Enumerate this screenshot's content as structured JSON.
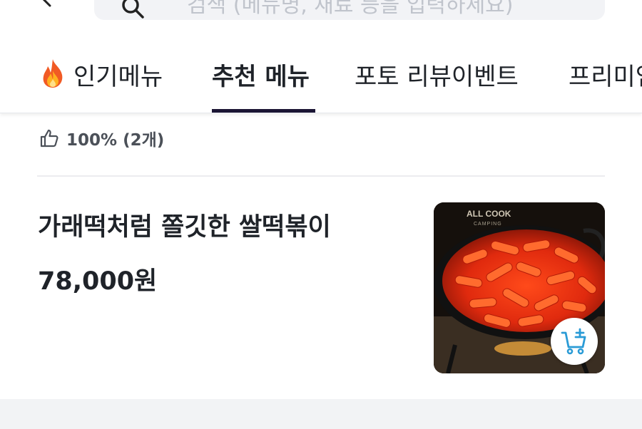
{
  "search": {
    "placeholder": "검색 (메뉴명, 재료 등을 입력하세요)"
  },
  "tabs": [
    {
      "label": "인기메뉴",
      "icon": "fire-icon",
      "active": false
    },
    {
      "label": "추천 메뉴",
      "active": true
    },
    {
      "label": "포토 리뷰이벤트",
      "active": false
    },
    {
      "label": "프리미엄",
      "active": false
    }
  ],
  "rating": {
    "icon": "thumbs-up-icon",
    "text": "100% (2개)"
  },
  "product": {
    "name": "가래떡처럼 쫄깃한 쌀떡볶이",
    "price": "78,000원",
    "image_caption_brand": "ALL COOK",
    "image_caption_sub": "CAMPING",
    "cart_icon": "add-to-cart-icon"
  },
  "colors": {
    "active_tab_underline": "#1b1534",
    "cart_icon": "#2a9bd6",
    "divider": "#ececef"
  }
}
